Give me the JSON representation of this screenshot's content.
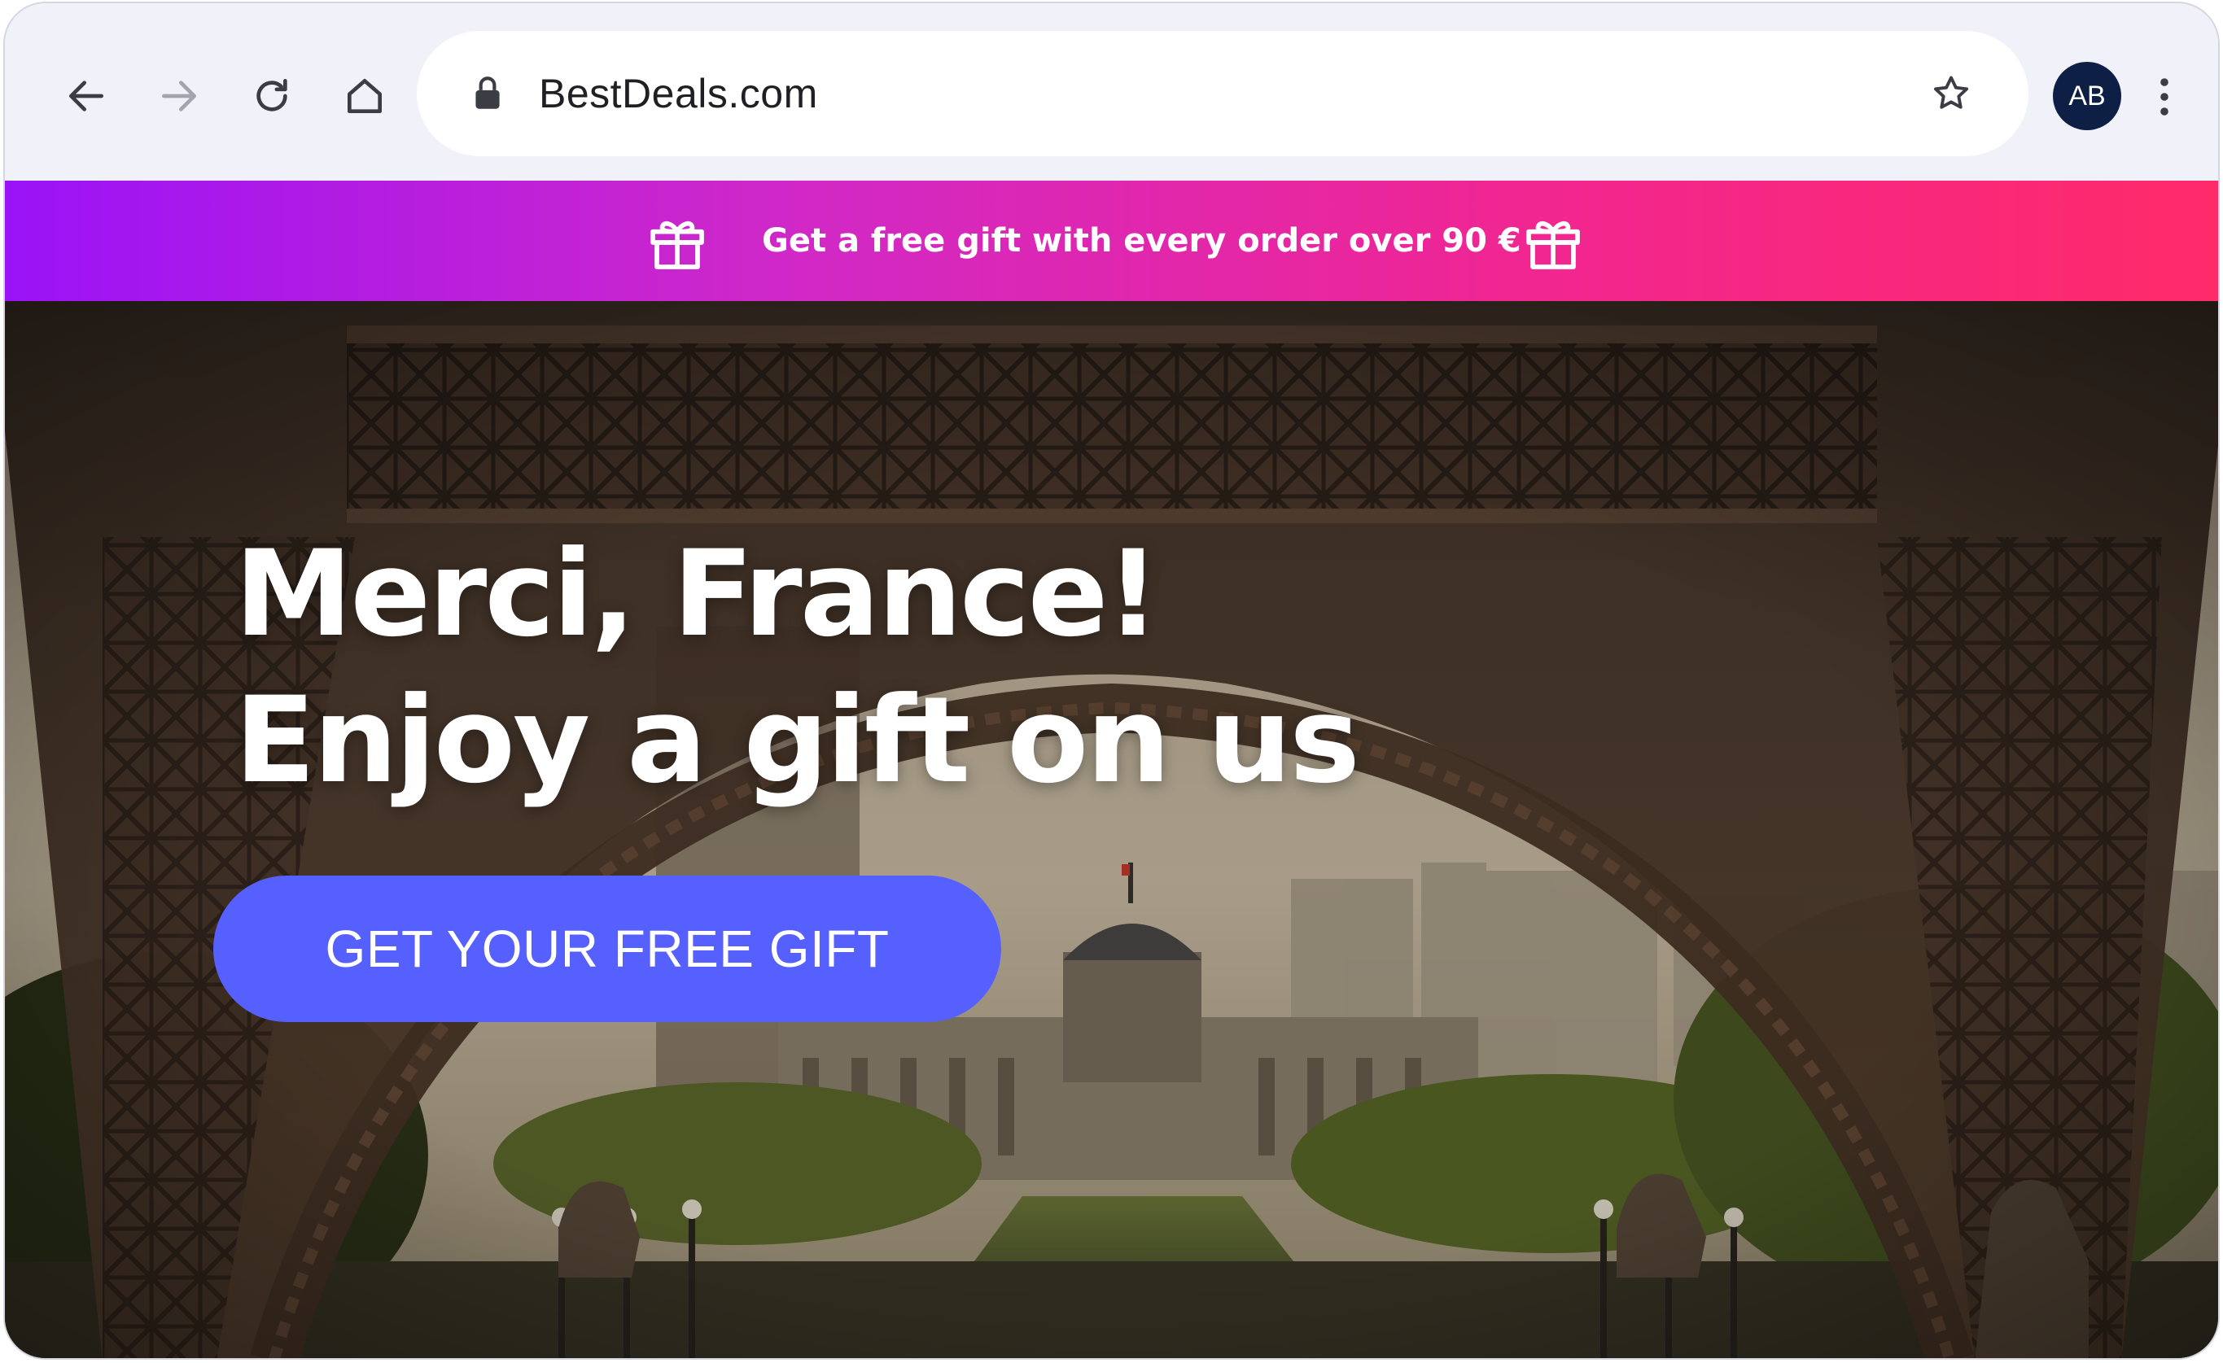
{
  "browser": {
    "url": "BestDeals.com",
    "profile_initials": "AB",
    "icons": {
      "back": "arrow-left-icon",
      "forward": "arrow-right-icon",
      "reload": "reload-icon",
      "home": "home-icon",
      "lock": "lock-icon",
      "bookmark": "star-icon",
      "menu": "vertical-dots-icon"
    }
  },
  "promo_banner": {
    "text": "Get a free gift with every order over 90 €",
    "icon": "gift-icon",
    "gradient": [
      "#9a13f7",
      "#ff2a6a"
    ]
  },
  "hero": {
    "headline_line1": "Merci, France!",
    "headline_line2": "Enjoy a gift on us",
    "cta_label": "GET YOUR FREE GIFT",
    "cta_color": "#5560ff",
    "background_image": "Eiffel Tower arch with Champ de Mars and École Militaire"
  }
}
